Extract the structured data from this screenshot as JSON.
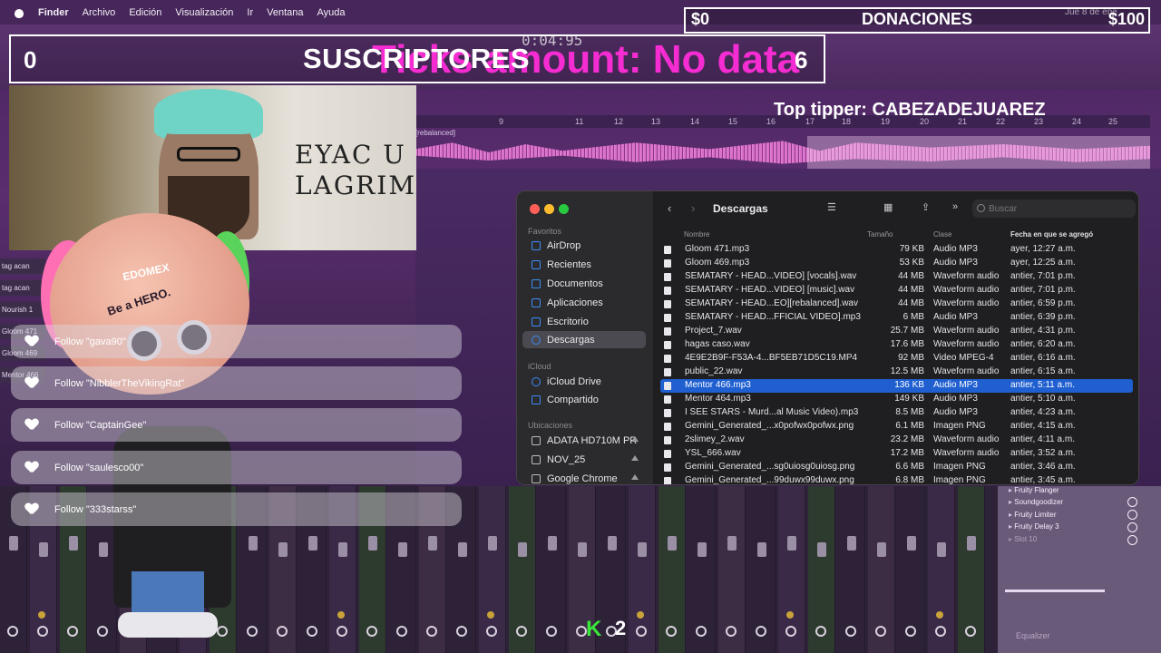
{
  "menubar": {
    "app": "Finder",
    "items": [
      "Archivo",
      "Edición",
      "Visualización",
      "Ir",
      "Ventana",
      "Ayuda"
    ],
    "clock": "Jue 8 de ene"
  },
  "daw": {
    "time": "0:04:95",
    "track_label": "[rebalanced]",
    "timeline_ticks": [
      "9",
      "11",
      "12",
      "13",
      "14",
      "15",
      "16",
      "17",
      "18",
      "19",
      "20",
      "21",
      "22",
      "23",
      "24",
      "25"
    ],
    "track_names": [
      "tag acan",
      "tag acan",
      "Nourish 1",
      "Gloom 471",
      "Gloom 469",
      "Mentor 466"
    ],
    "fx": [
      "Fruity Flanger",
      "Soundgoodizer",
      "Fruity Limiter",
      "Fruity Delay 3",
      "Slot 10"
    ],
    "fx_bottom": "Equalizer"
  },
  "overlay": {
    "subs_count": "0",
    "subs_title": "SUSCRIPTORES",
    "subs_goal": "6",
    "ticks_text": "Ticks amount: No data",
    "don_left": "$0",
    "don_title": "DONACIONES",
    "don_right": "$100",
    "top_tipper": "Top tipper: CABEZADEJUAREZ"
  },
  "webcam": {
    "sign_line1": "EYAC U",
    "sign_line2": "LAGRIMA"
  },
  "avatar": {
    "sticker": "EDOMEX",
    "hero": "Be a HERO."
  },
  "follows": [
    "Follow \"gava90\"",
    "Follow \"NibblerTheVikingRat\"",
    "Follow \"CaptainGee\"",
    "Follow \"saulesco00\"",
    "Follow \"333starss\""
  ],
  "finder": {
    "title": "Descargas",
    "search_placeholder": "Buscar",
    "sidebar_sections": [
      "Favoritos",
      "iCloud",
      "Ubicaciones"
    ],
    "favorites": [
      "AirDrop",
      "Recientes",
      "Documentos",
      "Aplicaciones",
      "Escritorio",
      "Descargas"
    ],
    "icloud": [
      "iCloud Drive",
      "Compartido"
    ],
    "locations": [
      "ADATA HD710M PR",
      "NOV_25",
      "Google Chrome"
    ],
    "columns": [
      "Nombre",
      "Tamaño",
      "Clase",
      "Fecha en que se agregó"
    ],
    "rows": [
      {
        "name": "Gloom 471.mp3",
        "size": "79 KB",
        "kind": "Audio MP3",
        "date": "ayer, 12:27 a.m."
      },
      {
        "name": "Gloom 469.mp3",
        "size": "53 KB",
        "kind": "Audio MP3",
        "date": "ayer, 12:25 a.m."
      },
      {
        "name": "SEMATARY - HEAD...VIDEO] [vocals].wav",
        "size": "44 MB",
        "kind": "Waveform audio",
        "date": "antier, 7:01 p.m."
      },
      {
        "name": "SEMATARY - HEAD...VIDEO] [music].wav",
        "size": "44 MB",
        "kind": "Waveform audio",
        "date": "antier, 7:01 p.m."
      },
      {
        "name": "SEMATARY - HEAD...EO][rebalanced].wav",
        "size": "44 MB",
        "kind": "Waveform audio",
        "date": "antier, 6:59 p.m."
      },
      {
        "name": "SEMATARY - HEAD...FFICIAL VIDEO].mp3",
        "size": "6 MB",
        "kind": "Audio MP3",
        "date": "antier, 6:39 p.m."
      },
      {
        "name": "Project_7.wav",
        "size": "25.7 MB",
        "kind": "Waveform audio",
        "date": "antier, 4:31 p.m."
      },
      {
        "name": "hagas caso.wav",
        "size": "17.6 MB",
        "kind": "Waveform audio",
        "date": "antier, 6:20 a.m."
      },
      {
        "name": "4E9E2B9F-F53A-4...BF5EB71D5C19.MP4",
        "size": "92 MB",
        "kind": "Video MPEG-4",
        "date": "antier, 6:16 a.m."
      },
      {
        "name": "public_22.wav",
        "size": "12.5 MB",
        "kind": "Waveform audio",
        "date": "antier, 6:15 a.m."
      },
      {
        "name": "Mentor 466.mp3",
        "size": "136 KB",
        "kind": "Audio MP3",
        "date": "antier, 5:11 a.m."
      },
      {
        "name": "Mentor 464.mp3",
        "size": "149 KB",
        "kind": "Audio MP3",
        "date": "antier, 5:10 a.m."
      },
      {
        "name": "I SEE STARS - Murd...al Music Video).mp3",
        "size": "8.5 MB",
        "kind": "Audio MP3",
        "date": "antier, 4:23 a.m."
      },
      {
        "name": "Gemini_Generated_...x0pofwx0pofwx.png",
        "size": "6.1 MB",
        "kind": "Imagen PNG",
        "date": "antier, 4:15 a.m."
      },
      {
        "name": "2slimey_2.wav",
        "size": "23.2 MB",
        "kind": "Waveform audio",
        "date": "antier, 4:11 a.m."
      },
      {
        "name": "YSL_666.wav",
        "size": "17.2 MB",
        "kind": "Waveform audio",
        "date": "antier, 3:52 a.m."
      },
      {
        "name": "Gemini_Generated_...sg0uiosg0uiosg.png",
        "size": "6.6 MB",
        "kind": "Imagen PNG",
        "date": "antier, 3:46 a.m."
      },
      {
        "name": "Gemini_Generated_...99duwx99duwx.png",
        "size": "6.8 MB",
        "kind": "Imagen PNG",
        "date": "antier, 3:45 a.m."
      }
    ],
    "selected_index": 10
  },
  "corner": {
    "k_num": "2"
  },
  "colors": {
    "accent": "#1f5fd0",
    "ticks": "#ff2dd8",
    "k": "#39e639"
  }
}
